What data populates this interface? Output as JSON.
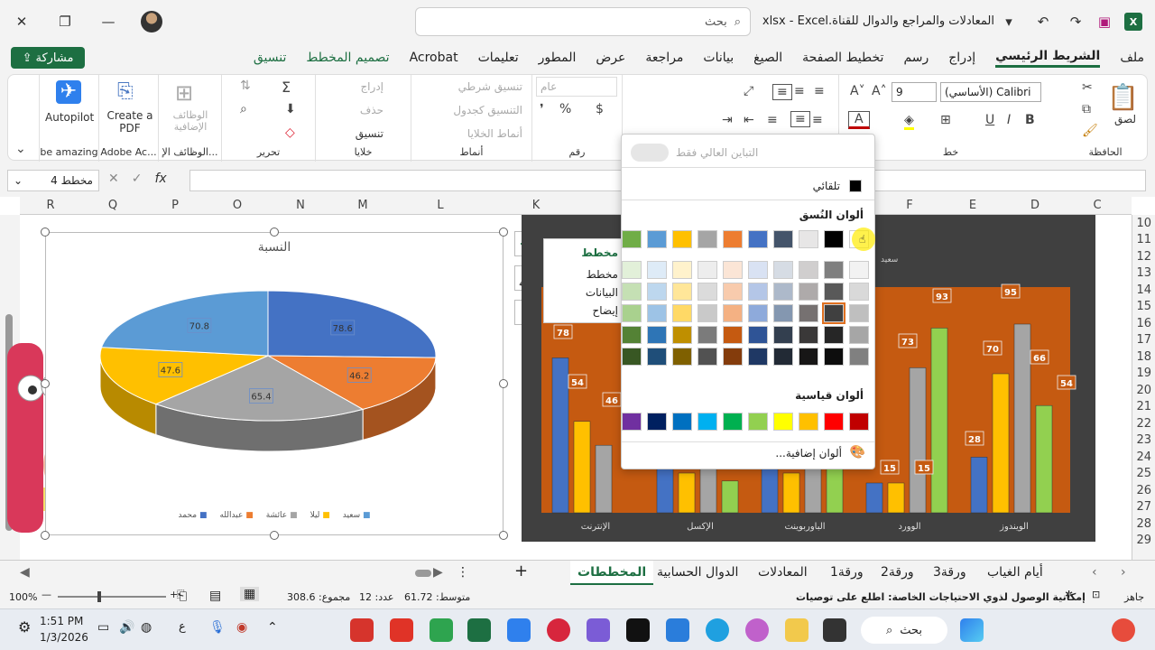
{
  "titlebar": {
    "title": "المعادلات والمراجع والدوال للقناة.xlsx  -  Excel",
    "search_placeholder": "بحث",
    "search_icon": "search-icon"
  },
  "menu": {
    "items": [
      "ملف",
      "الشريط الرئيسي",
      "إدراج",
      "رسم",
      "تخطيط الصفحة",
      "الصيغ",
      "بيانات",
      "مراجعة",
      "عرض",
      "المطور",
      "تعليمات",
      "Acrobat",
      "تصميم المخطط",
      "تنسيق"
    ],
    "share": "مشاركة"
  },
  "ribbon": {
    "clipboard": {
      "label": "الحافظة",
      "paste": "لصق"
    },
    "font": {
      "label": "خط",
      "font_name": "Calibri (الأساسي)",
      "font_size": "9"
    },
    "number": {
      "label": "رقم",
      "format": "عام"
    },
    "styles": {
      "label": "أنماط",
      "conditional": "تنسيق شرطي",
      "as_table": "التنسيق كجدول",
      "cell_styles": "أنماط الخلايا"
    },
    "cells": {
      "label": "خلايا",
      "insert": "إدراج",
      "delete": "حذف",
      "format": "تنسيق"
    },
    "editing": {
      "label": "تحرير"
    },
    "addins": {
      "label": "الوظائف الإ...",
      "button": "الوظائف الإضافية"
    },
    "acrobat": {
      "label": "Adobe Ac...",
      "button": "Create a PDF"
    },
    "autopilot": {
      "label": "be amazing",
      "button": "Autopilot"
    }
  },
  "formula": {
    "name_box": "مخطط 4",
    "fx": "fx"
  },
  "columns": [
    "R",
    "Q",
    "P",
    "O",
    "N",
    "M",
    "L",
    "K",
    "F",
    "E",
    "D",
    "C"
  ],
  "rows": [
    "10",
    "11",
    "12",
    "13",
    "14",
    "15",
    "16",
    "17",
    "18",
    "19",
    "20",
    "21",
    "22",
    "23",
    "24",
    "25",
    "26",
    "27",
    "28",
    "29"
  ],
  "chart1": {
    "title": "النسبة",
    "labels": [
      "78.6",
      "46.2",
      "65.4",
      "47.6",
      "70.8"
    ],
    "legend": [
      "محمد",
      "عبدالله",
      "عائشة",
      "ليلا",
      "سعيد"
    ]
  },
  "chart2": {
    "categories": [
      "الإنترنت",
      "الإكسل",
      "الباوربوينت",
      "الوورد",
      "الويندوز"
    ],
    "labels": [
      "78",
      "54",
      "46",
      "93",
      "95",
      "73",
      "70",
      "66",
      "54",
      "28",
      "15",
      "15"
    ],
    "tag": "سعيد"
  },
  "chart_menu": {
    "items": [
      "مخطط",
      "البيانات",
      "إيضاح"
    ]
  },
  "palette": {
    "contrast": "التباين العالي فقط",
    "automatic": "تلقائي",
    "theme_title": "ألوان النُسق",
    "standard_title": "ألوان قياسية",
    "more": "ألوان إضافية...",
    "theme_top": [
      "#ffffff",
      "#000000",
      "#e7e6e6",
      "#44546a",
      "#4472c4",
      "#ed7d31",
      "#a5a5a5",
      "#ffc000",
      "#5b9bd5",
      "#70ad47"
    ],
    "standard": [
      "#c00000",
      "#ff0000",
      "#ffc000",
      "#ffff00",
      "#92d050",
      "#00b050",
      "#00b0f0",
      "#0070c0",
      "#002060",
      "#7030a0"
    ]
  },
  "tabs": [
    "أيام الغياب",
    "ورقة3",
    "ورقة2",
    "ورقة1",
    "المعادلات",
    "الدوال الحسابية",
    "المخططات"
  ],
  "status": {
    "ready": "جاهز",
    "accessibility": "إمكانية الوصول لذوي الاحتياجات الخاصة: اطلع على توصيات",
    "average": "متوسط: 61.72",
    "count": "عدد: 12",
    "sum": "مجموع: 308.6",
    "zoom": "100%"
  },
  "taskbar": {
    "time": "1:51 PM",
    "date": "1/3/2026",
    "search": "بحث"
  }
}
